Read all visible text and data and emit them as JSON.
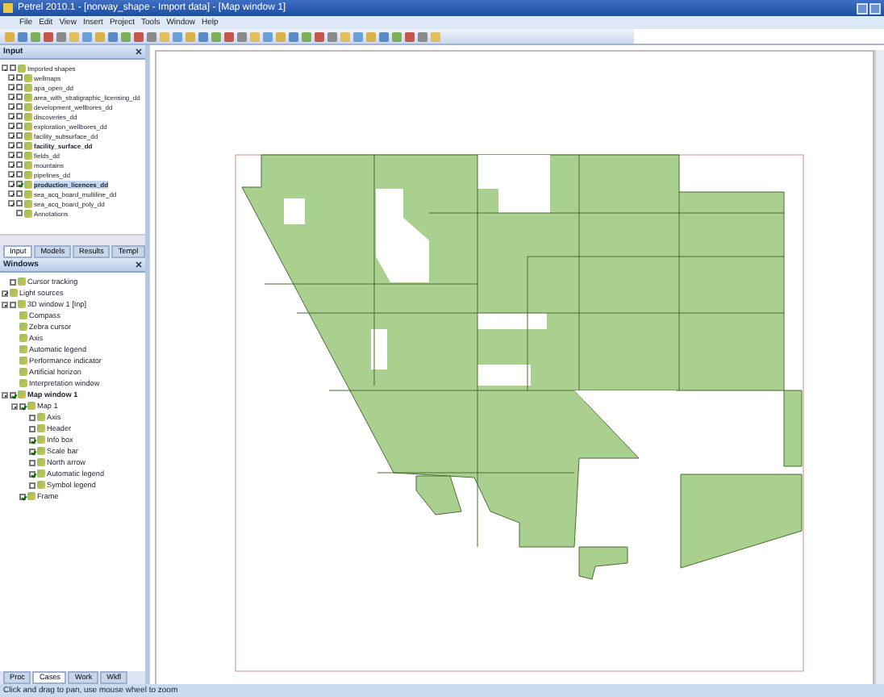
{
  "window": {
    "title": "Petrel 2010.1 - [norway_shape - Import data] - [Map window 1]"
  },
  "menu": [
    "File",
    "Edit",
    "View",
    "Insert",
    "Project",
    "Tools",
    "Window",
    "Help"
  ],
  "input_panel": {
    "title": "Input",
    "tree": [
      {
        "label": "Imported shapes",
        "checked": false,
        "expanded": true,
        "bold": false,
        "selected": false,
        "children": [
          {
            "label": "wellmaps",
            "checked": false,
            "expanded": false,
            "bold": false,
            "selected": false
          },
          {
            "label": "apa_open_dd",
            "checked": false,
            "expanded": false,
            "bold": false,
            "selected": false
          },
          {
            "label": "area_with_stratigraphic_licensing_dd",
            "checked": false,
            "expanded": false,
            "bold": false,
            "selected": false
          },
          {
            "label": "development_wellbores_dd",
            "checked": false,
            "expanded": false,
            "bold": false,
            "selected": false
          },
          {
            "label": "discoveries_dd",
            "checked": false,
            "expanded": false,
            "bold": false,
            "selected": false
          },
          {
            "label": "exploration_wellbores_dd",
            "checked": false,
            "expanded": false,
            "bold": false,
            "selected": false
          },
          {
            "label": "facility_subsurface_dd",
            "checked": false,
            "expanded": false,
            "bold": false,
            "selected": false
          },
          {
            "label": "facility_surface_dd",
            "checked": false,
            "expanded": false,
            "bold": true,
            "selected": false
          },
          {
            "label": "fields_dd",
            "checked": false,
            "expanded": false,
            "bold": false,
            "selected": false
          },
          {
            "label": "mountains",
            "checked": false,
            "expanded": false,
            "bold": false,
            "selected": false
          },
          {
            "label": "pipelines_dd",
            "checked": false,
            "expanded": false,
            "bold": false,
            "selected": false
          },
          {
            "label": "production_licences_dd",
            "checked": true,
            "expanded": false,
            "bold": true,
            "selected": true
          },
          {
            "label": "sea_acq_board_multiline_dd",
            "checked": false,
            "expanded": false,
            "bold": false,
            "selected": false
          },
          {
            "label": "sea_acq_board_poly_dd",
            "checked": false,
            "expanded": false,
            "bold": false,
            "selected": false
          },
          {
            "label": "Annotations",
            "checked": false,
            "bold": false,
            "selected": false
          }
        ]
      }
    ]
  },
  "panel_tabs": [
    {
      "label": "Input",
      "selected": true
    },
    {
      "label": "Models",
      "selected": false
    },
    {
      "label": "Results",
      "selected": false
    },
    {
      "label": "Templ",
      "selected": false
    }
  ],
  "windows_panel": {
    "title": "Windows",
    "tree": [
      {
        "label": "Cursor tracking",
        "checked": false,
        "bold": false,
        "selected": false
      },
      {
        "label": "Light sources",
        "expanded": false,
        "bold": false,
        "selected": false
      },
      {
        "label": "3D window 1 [Inp]",
        "checked": false,
        "expanded": true,
        "bold": false,
        "selected": false,
        "children": [
          {
            "label": "Compass",
            "bold": false,
            "selected": false
          },
          {
            "label": "Zebra cursor",
            "bold": false,
            "selected": false
          },
          {
            "label": "Axis",
            "bold": false,
            "selected": false
          },
          {
            "label": "Automatic legend",
            "bold": false,
            "selected": false
          },
          {
            "label": "Performance indicator",
            "bold": false,
            "selected": false
          },
          {
            "label": "Artificial horizon",
            "bold": false,
            "selected": false
          },
          {
            "label": "Interpretation window",
            "bold": false,
            "selected": false
          }
        ]
      },
      {
        "label": "Map window 1",
        "checked": true,
        "expanded": true,
        "bold": true,
        "selected": false,
        "children": [
          {
            "label": "Map 1",
            "checked": true,
            "expanded": true,
            "bold": false,
            "selected": false,
            "children": [
              {
                "label": "Axis",
                "checked": false,
                "bold": false,
                "selected": false
              },
              {
                "label": "Header",
                "checked": false,
                "bold": false,
                "selected": false
              },
              {
                "label": "Info box",
                "checked": true,
                "bold": false,
                "selected": false
              },
              {
                "label": "Scale bar",
                "checked": true,
                "bold": false,
                "selected": false
              },
              {
                "label": "North arrow",
                "checked": false,
                "bold": false,
                "selected": false
              },
              {
                "label": "Automatic legend",
                "checked": true,
                "bold": false,
                "selected": false
              },
              {
                "label": "Symbol legend",
                "checked": false,
                "bold": false,
                "selected": false
              }
            ]
          },
          {
            "label": "Frame",
            "checked": true,
            "bold": false,
            "selected": false
          }
        ]
      }
    ]
  },
  "bottom_tabs": [
    {
      "label": "Proc",
      "selected": false
    },
    {
      "label": "Cases",
      "selected": true
    },
    {
      "label": "Work",
      "selected": false
    },
    {
      "label": "Wkfl",
      "selected": false
    }
  ],
  "status_bar": "Click and drag to pan, use mouse wheel to zoom"
}
